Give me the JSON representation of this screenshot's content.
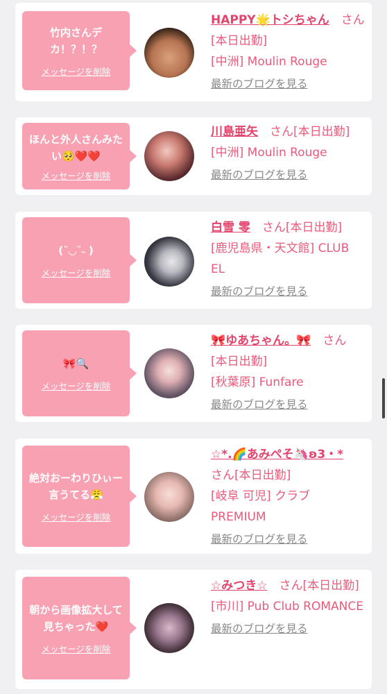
{
  "cards": [
    {
      "message": "竹内さんデカ！？！？",
      "delete_label": "メッセージを削除",
      "name": "HAPPY🌟トシちゃん",
      "san": "さん",
      "status": "[本日出勤]",
      "location": "[中洲] Moulin Rouge",
      "blog_link": "最新のブログを見る"
    },
    {
      "message": "ほんと外人さんみたい🥺❤️❤️",
      "delete_label": "メッセージを削除",
      "name": "川島亜矢",
      "san": "さん",
      "status": "[本日出勤]",
      "location": "[中洲] Moulin Rouge",
      "blog_link": "最新のブログを見る"
    },
    {
      "message": "(˘◡˘˵ )",
      "delete_label": "メッセージを削除",
      "name": "白雪 零",
      "san": "さん",
      "status": "[本日出勤]",
      "location": "[鹿児島県・天文館] CLUB EL",
      "blog_link": "最新のブログを見る"
    },
    {
      "message": "🎀🔍",
      "delete_label": "メッセージを削除",
      "name": "🎀ゆあちゃん。🎀",
      "san": "さん",
      "status": "[本日出勤]",
      "location": "[秋葉原] Funfare",
      "blog_link": "最新のブログを見る"
    },
    {
      "message": "絶対おーわりひぃー言うてる😤",
      "delete_label": "メッセージを削除",
      "name": "☆*.🌈あみぺそ🦄ʚ3・*",
      "san": "さん",
      "status": "[本日出勤]",
      "location": "[岐阜 可児] クラブPREMIUM",
      "blog_link": "最新のブログを見る"
    },
    {
      "message": "朝から画像拡大して見ちゃった❤️",
      "delete_label": "メッセージを削除",
      "name": "☆みつき☆",
      "san": "さん",
      "status": "[本日出勤]",
      "location": "[市川] Pub Club ROMANCE",
      "blog_link": "最新のブログを見る"
    }
  ]
}
